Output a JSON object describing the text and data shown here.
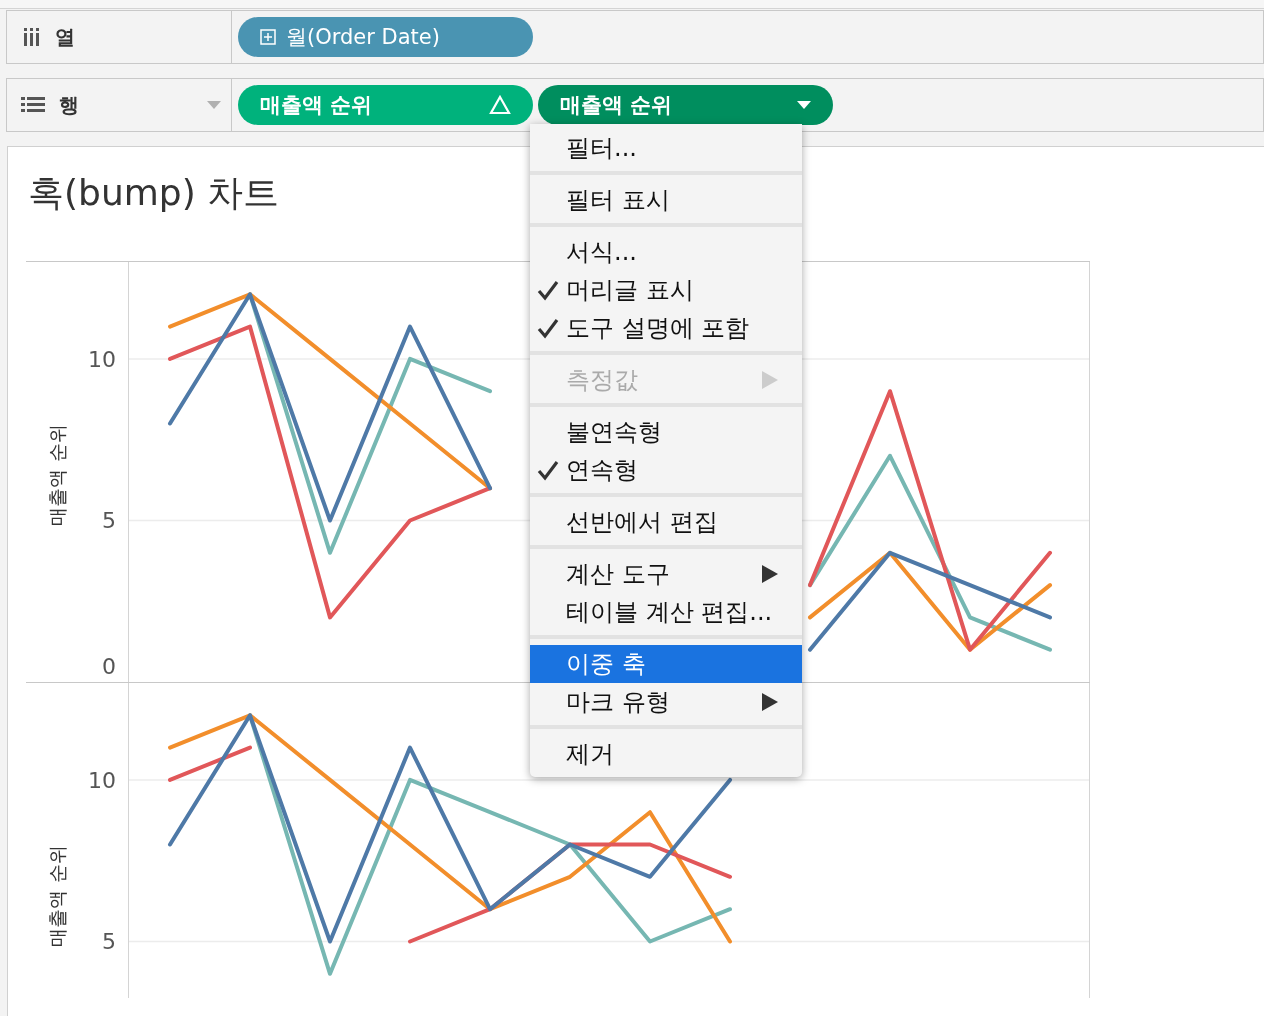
{
  "shelves": [
    {
      "kind": "columns",
      "label": "열",
      "pills": [
        {
          "label": "월(Order Date)",
          "kind": "dimension"
        }
      ]
    },
    {
      "kind": "rows",
      "label": "행",
      "pills": [
        {
          "label": "매출액 순위",
          "kind": "measure",
          "selected": false
        },
        {
          "label": "매출액 순위",
          "kind": "measure",
          "selected": true
        }
      ]
    }
  ],
  "sheet": {
    "title": "혹(bump) 차트",
    "panes": [
      {
        "chart_data": {
          "type": "line",
          "ylabel": "매출액 순위",
          "ylim": [
            0,
            13
          ],
          "yticks": [
            0,
            5,
            10
          ],
          "series": [
            {
              "color": "#76b7b2",
              "values": [
                null,
                12,
                4,
                10,
                9,
                null,
                null,
                null,
                3,
                7,
                2,
                1
              ]
            },
            {
              "color": "#f28e2b",
              "values": [
                11,
                12,
                10,
                8,
                6,
                null,
                null,
                null,
                2,
                4,
                1,
                3
              ]
            },
            {
              "color": "#e15759",
              "values": [
                10,
                11,
                2,
                5,
                6,
                null,
                null,
                null,
                3,
                9,
                1,
                4
              ]
            },
            {
              "color": "#4e79a7",
              "values": [
                8,
                12,
                5,
                11,
                6,
                null,
                null,
                null,
                1,
                4,
                3,
                2
              ]
            }
          ]
        }
      },
      {
        "chart_data": {
          "type": "line",
          "ylabel": "매출액 순위",
          "ylim": [
            3.25,
            13
          ],
          "yticks": [
            5,
            10
          ],
          "series": [
            {
              "color": "#76b7b2",
              "values": [
                null,
                12,
                4,
                10,
                9,
                8,
                5,
                6,
                null,
                null,
                null,
                null
              ]
            },
            {
              "color": "#f28e2b",
              "values": [
                11,
                12,
                10,
                8,
                6,
                7,
                9,
                5,
                null,
                null,
                null,
                null
              ]
            },
            {
              "color": "#e15759",
              "values": [
                10,
                11,
                null,
                5,
                6,
                8,
                8,
                7,
                null,
                null,
                null,
                null
              ]
            },
            {
              "color": "#4e79a7",
              "values": [
                8,
                12,
                5,
                11,
                6,
                8,
                7,
                10,
                null,
                null,
                null,
                null
              ]
            }
          ]
        }
      }
    ]
  },
  "context_menu": {
    "groups": [
      [
        {
          "label": "필터...",
          "checked": false,
          "disabled": false,
          "submenu": false,
          "selected": false
        }
      ],
      [
        {
          "label": "필터 표시",
          "checked": false,
          "disabled": false,
          "submenu": false,
          "selected": false
        }
      ],
      [
        {
          "label": "서식...",
          "checked": false,
          "disabled": false,
          "submenu": false,
          "selected": false
        },
        {
          "label": "머리글 표시",
          "checked": true,
          "disabled": false,
          "submenu": false,
          "selected": false
        },
        {
          "label": "도구 설명에 포함",
          "checked": true,
          "disabled": false,
          "submenu": false,
          "selected": false
        }
      ],
      [
        {
          "label": "측정값",
          "checked": false,
          "disabled": true,
          "submenu": true,
          "selected": false
        }
      ],
      [
        {
          "label": "불연속형",
          "checked": false,
          "disabled": false,
          "submenu": false,
          "selected": false
        },
        {
          "label": "연속형",
          "checked": true,
          "disabled": false,
          "submenu": false,
          "selected": false
        }
      ],
      [
        {
          "label": "선반에서 편집",
          "checked": false,
          "disabled": false,
          "submenu": false,
          "selected": false
        }
      ],
      [
        {
          "label": "계산 도구",
          "checked": false,
          "disabled": false,
          "submenu": true,
          "selected": false
        },
        {
          "label": "테이블 계산 편집...",
          "checked": false,
          "disabled": false,
          "submenu": false,
          "selected": false
        }
      ],
      [
        {
          "label": "이중 축",
          "checked": false,
          "disabled": false,
          "submenu": false,
          "selected": true
        },
        {
          "label": "마크 유형",
          "checked": false,
          "disabled": false,
          "submenu": true,
          "selected": false
        }
      ],
      [
        {
          "label": "제거",
          "checked": false,
          "disabled": false,
          "submenu": false,
          "selected": false
        }
      ]
    ]
  }
}
